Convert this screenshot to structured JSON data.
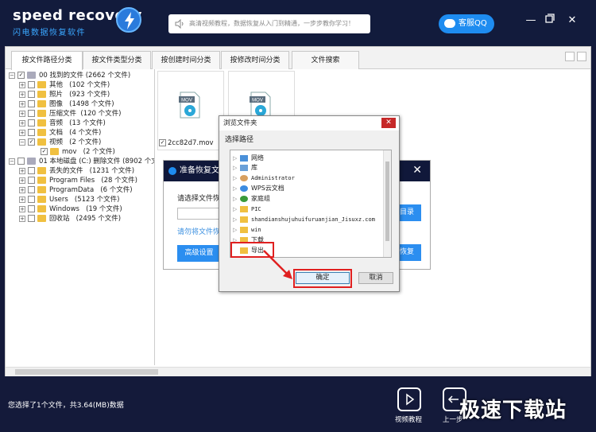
{
  "app": {
    "title": "speed recovery",
    "subtitle": "闪电数据恢复软件"
  },
  "search": {
    "text": "高清视频教程，数据恢复从入门到精通，一步步教你学习！"
  },
  "qq": {
    "label": "客服QQ"
  },
  "window_buttons": {
    "min": "—",
    "max": "□",
    "close": "✕"
  },
  "tabs": [
    {
      "label": "按文件路径分类"
    },
    {
      "label": "按文件类型分类"
    },
    {
      "label": "按创建时间分类"
    },
    {
      "label": "按修改时间分类"
    },
    {
      "label": "文件搜索"
    }
  ],
  "tree": [
    {
      "label": "00 找到的文件",
      "count": "(2662 个文件)"
    },
    {
      "label": "其他",
      "count": "(102 个文件)"
    },
    {
      "label": "照片",
      "count": "(923 个文件)"
    },
    {
      "label": "图像",
      "count": "(1498 个文件)"
    },
    {
      "label": "压缩文件",
      "count": "(120 个文件)"
    },
    {
      "label": "音频",
      "count": "(13 个文件)"
    },
    {
      "label": "文档",
      "count": "(4 个文件)"
    },
    {
      "label": "视频",
      "count": "(2 个文件)"
    },
    {
      "label": "mov",
      "count": "(2 个文件)"
    },
    {
      "label": "01 本地磁盘 (C:) 删除文件",
      "count": "(8902 个文件)"
    },
    {
      "label": "丢失的文件",
      "count": "(1231 个文件)"
    },
    {
      "label": "Program Files",
      "count": "(28 个文件)"
    },
    {
      "label": "ProgramData",
      "count": "(6 个文件)"
    },
    {
      "label": "Users",
      "count": "(5123 个文件)"
    },
    {
      "label": "Windows",
      "count": "(19 个文件)"
    },
    {
      "label": "回收站",
      "count": "(2495 个文件)"
    }
  ],
  "files": [
    {
      "name": "",
      "badge": "MOV"
    },
    {
      "name": "2cc82d7.mov",
      "badge": "MOV"
    }
  ],
  "restore_dialog": {
    "title": "准备恢复文件",
    "path_label": "请选择文件恢复",
    "warning": "请勿将文件恢复",
    "advanced": "高级设置",
    "browse": "浏览目录",
    "recover": "立即恢复"
  },
  "browse_dialog": {
    "title": "浏览文件夹",
    "close": "✕",
    "select_path": "选择路径",
    "items": [
      {
        "label": "网络"
      },
      {
        "label": "库"
      },
      {
        "label": "Administrator"
      },
      {
        "label": "WPS云文档"
      },
      {
        "label": "家庭组"
      },
      {
        "label": "PIC"
      },
      {
        "label": "shandianshujuhuifuruanjian_Jisuxz.com"
      },
      {
        "label": "win"
      },
      {
        "label": "下载"
      },
      {
        "label": "导出"
      }
    ],
    "ok": "确定",
    "cancel": "取消"
  },
  "status": {
    "text": "您选择了1个文件，共3.64(MB)数据"
  },
  "bottom_buttons": {
    "tutorial": "视频教程",
    "back": "上一步"
  },
  "watermark": "极速下载站"
}
